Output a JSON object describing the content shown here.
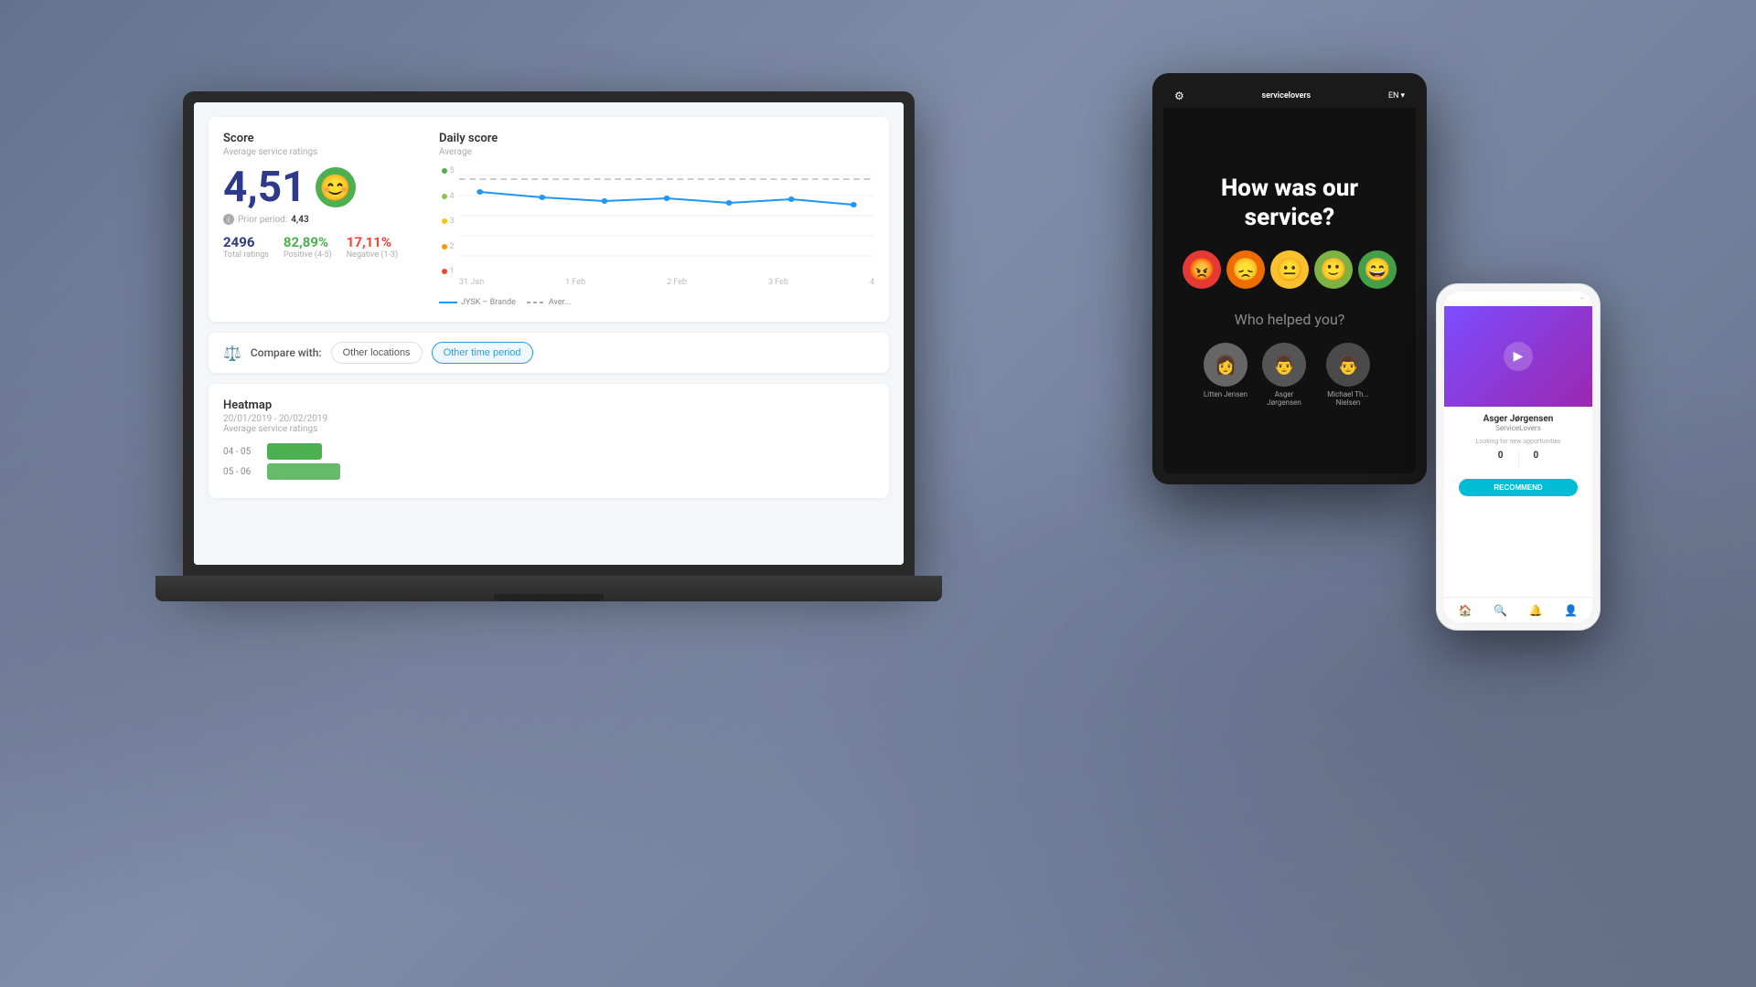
{
  "background": {
    "color": "#5a6a8a"
  },
  "laptop": {
    "dashboard": {
      "score_section": {
        "title": "Score",
        "subtitle": "Average service ratings",
        "big_score": "4,51",
        "prior_label": "Prior period:",
        "prior_value": "4,43",
        "total_ratings_value": "2496",
        "total_ratings_label": "Total ratings",
        "positive_value": "82,89%",
        "positive_label": "Positive (4-5)",
        "negative_value": "17,11%",
        "negative_label": "Negative (1-3)"
      },
      "chart_section": {
        "title": "Daily score",
        "subtitle": "Average",
        "y_labels": [
          "5",
          "4",
          "3",
          "2",
          "1"
        ],
        "x_labels": [
          "31 Jan",
          "1 Feb",
          "2 Feb",
          "3 Feb",
          "4"
        ],
        "legend_jysk": "JYSK – Brande",
        "legend_avg": "Aver..."
      },
      "compare": {
        "label": "Compare with:",
        "btn1": "Other locations",
        "btn2": "Other time period"
      },
      "heatmap": {
        "title": "Heatmap",
        "date_range": "20/01/2019 - 20/02/2019",
        "subtitle": "Average service ratings",
        "rows": [
          {
            "label": "04 - 05",
            "width": 60
          },
          {
            "label": "05 - 06",
            "width": 80
          }
        ]
      }
    }
  },
  "tablet": {
    "header": {
      "logo": "servicelovers",
      "lang": "EN"
    },
    "question": "How was our service?",
    "emojis": [
      "😡",
      "😞",
      "😐",
      "🙂",
      "😄"
    ],
    "who_helped": "Who helped you?",
    "staff": [
      {
        "name": "Litten Jensen",
        "avatar": "👩"
      },
      {
        "name": "Asger Jørgensen",
        "avatar": "👨"
      },
      {
        "name": "Michael Th... Nielsen",
        "avatar": "👨"
      }
    ]
  },
  "phone": {
    "profile_name": "Asger Jørgensen",
    "profile_title": "ServiceLovers",
    "profile_subtitle": "Looking for new opportunities",
    "stats": [
      {
        "num": "0",
        "label": ""
      },
      {
        "num": "0",
        "label": ""
      }
    ],
    "recommend_btn": "RECOMMEND",
    "nav_icons": [
      "🏠",
      "🔍",
      "🔔",
      "👤"
    ]
  }
}
